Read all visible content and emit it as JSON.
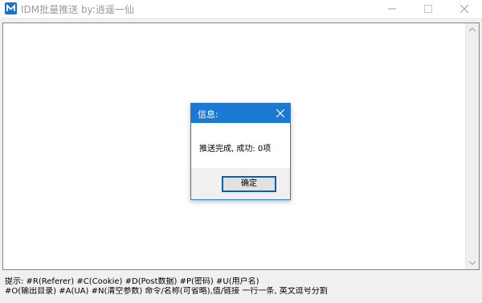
{
  "window": {
    "title": "IDM批量推送  by:逍遥一仙",
    "icon": "idm-app-icon",
    "controls": [
      "minimize-icon",
      "maximize-icon",
      "close-icon"
    ]
  },
  "editor": {
    "value": ""
  },
  "hints": {
    "line1": "提示: #R(Referer) #C(Cookie) #D(Post数据) #P(密码) #U(用户名)",
    "line2": "#O(输出目录) #A(UA) #N(清空参数) 命令/名称(可省略),值/链接 一行一条, 英文逗号分割"
  },
  "dialog": {
    "title": "信息:",
    "message": "推送完成, 成功: 0项",
    "ok_label": "确定"
  },
  "colors": {
    "accent": "#1a79d2",
    "button_border": "#0a5fb4"
  }
}
